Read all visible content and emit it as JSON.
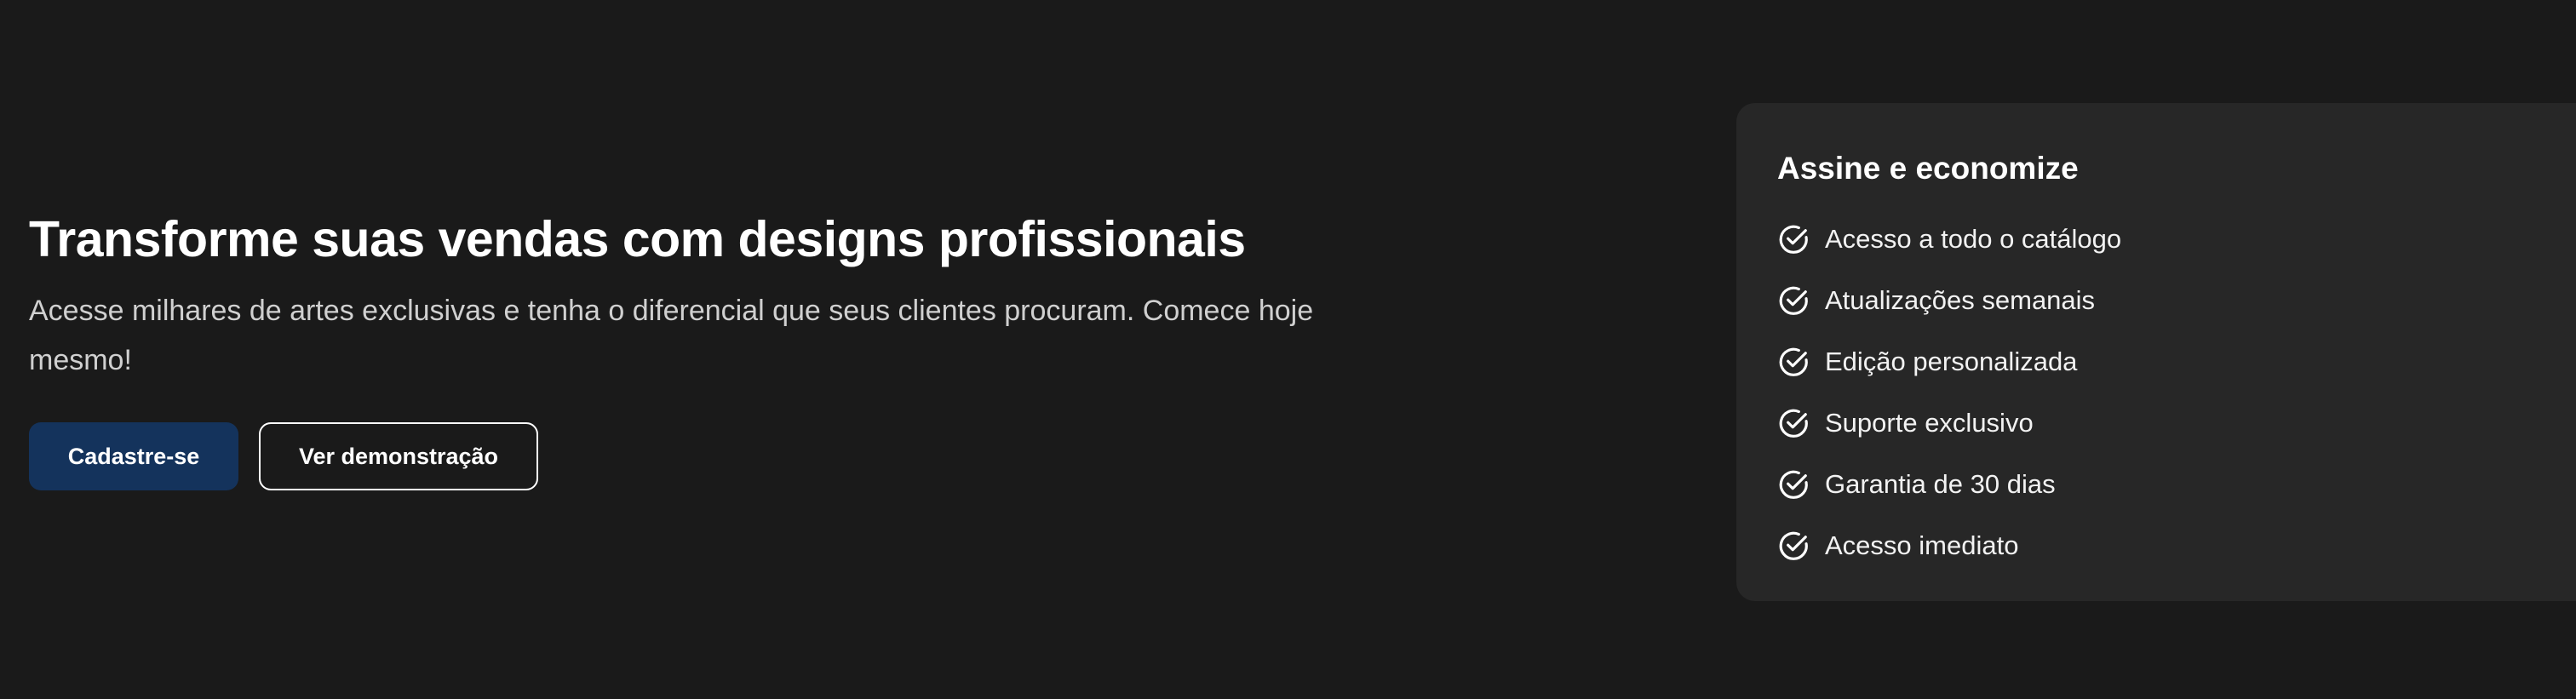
{
  "hero": {
    "title": "Transforme suas vendas com designs profissionais",
    "subtitle": "Acesse milhares de artes exclusivas e tenha o diferencial que seus clientes procuram. Comece hoje mesmo!",
    "primary_button": "Cadastre-se",
    "secondary_button": "Ver demonstração"
  },
  "plan_card": {
    "title": "Assine e economize",
    "features": [
      {
        "label": "Acesso a todo o catálogo",
        "icon": "check-circle-icon"
      },
      {
        "label": "Atualizações semanais",
        "icon": "check-circle-icon"
      },
      {
        "label": "Edição personalizada",
        "icon": "check-circle-icon"
      },
      {
        "label": "Suporte exclusivo",
        "icon": "check-circle-icon"
      },
      {
        "label": "Garantia de 30 dias",
        "icon": "check-circle-icon"
      },
      {
        "label": "Acesso imediato",
        "icon": "check-circle-icon"
      }
    ]
  },
  "colors": {
    "background": "#1a1a1a",
    "card_background": "#272727",
    "primary_button": "#14335c",
    "text": "#ffffff",
    "subtitle_text": "#d0d0d0"
  }
}
